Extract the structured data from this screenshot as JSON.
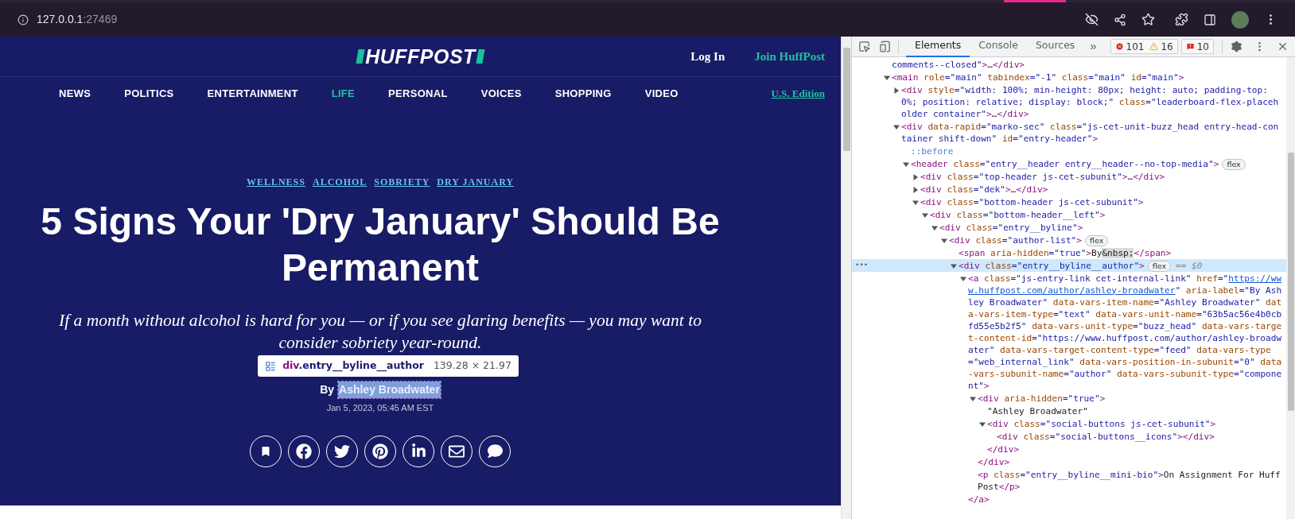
{
  "browser": {
    "address_host": "127.0.0.1",
    "address_port": ":27469"
  },
  "site": {
    "logo": "HUFFPOST",
    "login": "Log In",
    "join": "Join HuffPost",
    "edition": "U.S. Edition",
    "nav": [
      {
        "label": "NEWS",
        "selected": false
      },
      {
        "label": "POLITICS",
        "selected": false
      },
      {
        "label": "ENTERTAINMENT",
        "selected": false
      },
      {
        "label": "LIFE",
        "selected": true
      },
      {
        "label": "PERSONAL",
        "selected": false
      },
      {
        "label": "VOICES",
        "selected": false
      },
      {
        "label": "SHOPPING",
        "selected": false
      },
      {
        "label": "VIDEO",
        "selected": false
      }
    ]
  },
  "article": {
    "tags": [
      "WELLNESS",
      "ALCOHOL",
      "SOBRIETY",
      "DRY JANUARY"
    ],
    "title": "5 Signs Your 'Dry January' Should Be Permanent",
    "dek": "If a month without alcohol is hard for you — or if you see glaring benefits — you may want to consider sobriety year-round.",
    "byline_prefix": "By",
    "author": "Ashley Broadwater",
    "author_highlighted": true,
    "date": "Jan 5, 2023, 05:45 AM EST",
    "share_buttons": [
      {
        "kind": "bookmark"
      },
      {
        "kind": "facebook"
      },
      {
        "kind": "twitter"
      },
      {
        "kind": "pinterest"
      },
      {
        "kind": "linkedin"
      },
      {
        "kind": "email"
      },
      {
        "kind": "comment"
      }
    ]
  },
  "inspect_tooltip": {
    "tag": "div",
    "class_name": ".entry__byline__author",
    "size": "139.28 × 21.97"
  },
  "devtools": {
    "tabs": [
      {
        "label": "Elements",
        "selected": true
      },
      {
        "label": "Console",
        "selected": false
      },
      {
        "label": "Sources",
        "selected": false
      }
    ],
    "more_tabs": "»",
    "errors": "101",
    "warnings": "16",
    "issues": "10",
    "tree": [
      {
        "tokens": [
          {
            "kind": "val",
            "text": "comments--closed\""
          },
          {
            "kind": "tag",
            "text": ">"
          },
          {
            "kind": "text",
            "text": "…"
          },
          {
            "kind": "tag",
            "text": "</div>"
          }
        ],
        "selected": false
      },
      {
        "tokens": [
          {
            "kind": "tag",
            "text": "<main"
          },
          {
            "kind": "attr",
            "text": " role"
          },
          {
            "kind": "val",
            "text": "=\"main\""
          },
          {
            "kind": "attr",
            "text": " tabindex"
          },
          {
            "kind": "val",
            "text": "=\"-1\""
          },
          {
            "kind": "attr",
            "text": " class"
          },
          {
            "kind": "val",
            "text": "=\"main\""
          },
          {
            "kind": "attr",
            "text": " id"
          },
          {
            "kind": "val",
            "text": "=\"main\""
          },
          {
            "kind": "tag",
            "text": ">"
          }
        ],
        "expanded": true,
        "selected": false,
        "children": [
          {
            "tokens": [
              {
                "kind": "tag",
                "text": "<div"
              },
              {
                "kind": "attr",
                "text": " style"
              },
              {
                "kind": "val",
                "text": "=\"width: 100%; min-height: 80px; height: auto; padding-top: 0%; position: relative; display: block;\""
              },
              {
                "kind": "attr",
                "text": " class"
              },
              {
                "kind": "val",
                "text": "=\"leaderboard-flex-placeholder container\""
              },
              {
                "kind": "tag",
                "text": ">"
              },
              {
                "kind": "text",
                "text": "…"
              },
              {
                "kind": "tag",
                "text": "</div>"
              }
            ],
            "expanded": false,
            "selected": false
          },
          {
            "tokens": [
              {
                "kind": "tag",
                "text": "<div"
              },
              {
                "kind": "attr",
                "text": " data-rapid"
              },
              {
                "kind": "val",
                "text": "=\"marko-sec\""
              },
              {
                "kind": "attr",
                "text": " class"
              },
              {
                "kind": "val",
                "text": "=\"js-cet-unit-buzz_head entry-head-container shift-down\""
              },
              {
                "kind": "attr",
                "text": " id"
              },
              {
                "kind": "val",
                "text": "=\"entry-header\""
              },
              {
                "kind": "tag",
                "text": ">"
              }
            ],
            "expanded": true,
            "selected": false,
            "children": [
              {
                "tokens": [
                  {
                    "kind": "pseudo",
                    "text": "::before"
                  }
                ],
                "selected": false
              },
              {
                "tokens": [
                  {
                    "kind": "tag",
                    "text": "<header"
                  },
                  {
                    "kind": "attr",
                    "text": " class"
                  },
                  {
                    "kind": "val",
                    "text": "=\"entry__header entry__header--no-top-media\""
                  },
                  {
                    "kind": "tag",
                    "text": ">"
                  }
                ],
                "badge": "flex",
                "expanded": true,
                "selected": false,
                "children": [
                  {
                    "tokens": [
                      {
                        "kind": "tag",
                        "text": "<div"
                      },
                      {
                        "kind": "attr",
                        "text": " class"
                      },
                      {
                        "kind": "val",
                        "text": "=\"top-header js-cet-subunit\""
                      },
                      {
                        "kind": "tag",
                        "text": ">"
                      },
                      {
                        "kind": "text",
                        "text": "…"
                      },
                      {
                        "kind": "tag",
                        "text": "</div>"
                      }
                    ],
                    "expanded": false,
                    "selected": false
                  },
                  {
                    "tokens": [
                      {
                        "kind": "tag",
                        "text": "<div"
                      },
                      {
                        "kind": "attr",
                        "text": " class"
                      },
                      {
                        "kind": "val",
                        "text": "=\"dek\""
                      },
                      {
                        "kind": "tag",
                        "text": ">"
                      },
                      {
                        "kind": "text",
                        "text": "…"
                      },
                      {
                        "kind": "tag",
                        "text": "</div>"
                      }
                    ],
                    "expanded": false,
                    "selected": false
                  },
                  {
                    "tokens": [
                      {
                        "kind": "tag",
                        "text": "<div"
                      },
                      {
                        "kind": "attr",
                        "text": " class"
                      },
                      {
                        "kind": "val",
                        "text": "=\"bottom-header js-cet-subunit\""
                      },
                      {
                        "kind": "tag",
                        "text": ">"
                      }
                    ],
                    "expanded": true,
                    "selected": false,
                    "children": [
                      {
                        "tokens": [
                          {
                            "kind": "tag",
                            "text": "<div"
                          },
                          {
                            "kind": "attr",
                            "text": " class"
                          },
                          {
                            "kind": "val",
                            "text": "=\"bottom-header__left\""
                          },
                          {
                            "kind": "tag",
                            "text": ">"
                          }
                        ],
                        "expanded": true,
                        "selected": false,
                        "children": [
                          {
                            "tokens": [
                              {
                                "kind": "tag",
                                "text": "<div"
                              },
                              {
                                "kind": "attr",
                                "text": " class"
                              },
                              {
                                "kind": "val",
                                "text": "=\"entry__byline\""
                              },
                              {
                                "kind": "tag",
                                "text": ">"
                              }
                            ],
                            "expanded": true,
                            "selected": false,
                            "children": [
                              {
                                "tokens": [
                                  {
                                    "kind": "tag",
                                    "text": "<div"
                                  },
                                  {
                                    "kind": "attr",
                                    "text": " class"
                                  },
                                  {
                                    "kind": "val",
                                    "text": "=\"author-list\""
                                  },
                                  {
                                    "kind": "tag",
                                    "text": ">"
                                  }
                                ],
                                "badge": "flex",
                                "expanded": true,
                                "selected": false,
                                "children": [
                                  {
                                    "tokens": [
                                      {
                                        "kind": "tag",
                                        "text": "<span"
                                      },
                                      {
                                        "kind": "attr",
                                        "text": " aria-hidden"
                                      },
                                      {
                                        "kind": "val",
                                        "text": "=\"true\""
                                      },
                                      {
                                        "kind": "tag",
                                        "text": ">"
                                      },
                                      {
                                        "kind": "text",
                                        "text": "By"
                                      },
                                      {
                                        "kind": "ent",
                                        "text": "&nbsp;"
                                      },
                                      {
                                        "kind": "tag",
                                        "text": "</span>"
                                      }
                                    ],
                                    "selected": false
                                  },
                                  {
                                    "tokens": [
                                      {
                                        "kind": "tag",
                                        "text": "<div"
                                      },
                                      {
                                        "kind": "attr",
                                        "text": " class"
                                      },
                                      {
                                        "kind": "val",
                                        "text": "=\"entry__byline__author\""
                                      },
                                      {
                                        "kind": "tag",
                                        "text": ">"
                                      }
                                    ],
                                    "badge": "flex",
                                    "suffix": "== $0",
                                    "gutter": "•••",
                                    "expanded": true,
                                    "selected": true,
                                    "children": [
                                      {
                                        "tokens": [
                                          {
                                            "kind": "tag",
                                            "text": "<a"
                                          },
                                          {
                                            "kind": "attr",
                                            "text": " class"
                                          },
                                          {
                                            "kind": "val",
                                            "text": "=\"js-entry-link cet-internal-link\""
                                          },
                                          {
                                            "kind": "attr",
                                            "text": " href"
                                          },
                                          {
                                            "kind": "val",
                                            "text": "=\""
                                          },
                                          {
                                            "kind": "link",
                                            "text": "https://www.huffpost.com/author/ashley-broadwater"
                                          },
                                          {
                                            "kind": "val",
                                            "text": "\""
                                          },
                                          {
                                            "kind": "attr",
                                            "text": " aria-label"
                                          },
                                          {
                                            "kind": "val",
                                            "text": "=\"By Ashley Broadwater\""
                                          },
                                          {
                                            "kind": "attr",
                                            "text": " data-vars-item-name"
                                          },
                                          {
                                            "kind": "val",
                                            "text": "=\"Ashley Broadwater\""
                                          },
                                          {
                                            "kind": "attr",
                                            "text": " data-vars-item-type"
                                          },
                                          {
                                            "kind": "val",
                                            "text": "=\"text\""
                                          },
                                          {
                                            "kind": "attr",
                                            "text": " data-vars-unit-name"
                                          },
                                          {
                                            "kind": "val",
                                            "text": "=\"63b5ac56e4b0cbfd55e5b2f5\""
                                          },
                                          {
                                            "kind": "attr",
                                            "text": " data-vars-unit-type"
                                          },
                                          {
                                            "kind": "val",
                                            "text": "=\"buzz_head\""
                                          },
                                          {
                                            "kind": "attr",
                                            "text": " data-vars-target-content-id"
                                          },
                                          {
                                            "kind": "val",
                                            "text": "=\"https://www.huffpost.com/author/ashley-broadwater\""
                                          },
                                          {
                                            "kind": "attr",
                                            "text": " data-vars-target-content-type"
                                          },
                                          {
                                            "kind": "val",
                                            "text": "=\"feed\""
                                          },
                                          {
                                            "kind": "attr",
                                            "text": " data-vars-type"
                                          },
                                          {
                                            "kind": "val",
                                            "text": "=\"web_internal_link\""
                                          },
                                          {
                                            "kind": "attr",
                                            "text": " data-vars-position-in-subunit"
                                          },
                                          {
                                            "kind": "val",
                                            "text": "=\"0\""
                                          },
                                          {
                                            "kind": "attr",
                                            "text": " data-vars-subunit-name"
                                          },
                                          {
                                            "kind": "val",
                                            "text": "=\"author\""
                                          },
                                          {
                                            "kind": "attr",
                                            "text": " data-vars-subunit-type"
                                          },
                                          {
                                            "kind": "val",
                                            "text": "=\"component\""
                                          },
                                          {
                                            "kind": "tag",
                                            "text": ">"
                                          }
                                        ],
                                        "expanded": true,
                                        "selected": false,
                                        "children": [
                                          {
                                            "tokens": [
                                              {
                                                "kind": "tag",
                                                "text": "<div"
                                              },
                                              {
                                                "kind": "attr",
                                                "text": " aria-hidden"
                                              },
                                              {
                                                "kind": "val",
                                                "text": "=\"true\""
                                              },
                                              {
                                                "kind": "tag",
                                                "text": ">"
                                              }
                                            ],
                                            "expanded": true,
                                            "selected": false,
                                            "children": [
                                              {
                                                "tokens": [
                                                  {
                                                    "kind": "text",
                                                    "text": "\"Ashley Broadwater\""
                                                  }
                                                ],
                                                "selected": false
                                              },
                                              {
                                                "tokens": [
                                                  {
                                                    "kind": "tag",
                                                    "text": "<div"
                                                  },
                                                  {
                                                    "kind": "attr",
                                                    "text": " class"
                                                  },
                                                  {
                                                    "kind": "val",
                                                    "text": "=\"social-buttons js-cet-subunit\""
                                                  },
                                                  {
                                                    "kind": "tag",
                                                    "text": ">"
                                                  }
                                                ],
                                                "expanded": true,
                                                "selected": false,
                                                "children": [
                                                  {
                                                    "tokens": [
                                                      {
                                                        "kind": "tag",
                                                        "text": "<div"
                                                      },
                                                      {
                                                        "kind": "attr",
                                                        "text": " class"
                                                      },
                                                      {
                                                        "kind": "val",
                                                        "text": "=\"social-buttons__icons\""
                                                      },
                                                      {
                                                        "kind": "tag",
                                                        "text": "></div>"
                                                      }
                                                    ],
                                                    "selected": false
                                                  }
                                                ],
                                                "closing": [
                                                  {
                                                    "kind": "tag",
                                                    "text": "</div>"
                                                  }
                                                ]
                                              }
                                            ],
                                            "closing": [
                                              {
                                                "kind": "tag",
                                                "text": "</div>"
                                              }
                                            ]
                                          },
                                          {
                                            "tokens": [
                                              {
                                                "kind": "tag",
                                                "text": "<p"
                                              },
                                              {
                                                "kind": "attr",
                                                "text": " class"
                                              },
                                              {
                                                "kind": "val",
                                                "text": "=\"entry__byline__mini-bio\""
                                              },
                                              {
                                                "kind": "tag",
                                                "text": ">"
                                              },
                                              {
                                                "kind": "text",
                                                "text": "On Assignment For HuffPost"
                                              },
                                              {
                                                "kind": "tag",
                                                "text": "</p>"
                                              }
                                            ],
                                            "selected": false
                                          }
                                        ],
                                        "closing": [
                                          {
                                            "kind": "tag",
                                            "text": "</a>"
                                          }
                                        ]
                                      }
                                    ]
                                  }
                                ]
                              }
                            ]
                          }
                        ]
                      }
                    ]
                  }
                ]
              }
            ]
          }
        ]
      }
    ]
  }
}
